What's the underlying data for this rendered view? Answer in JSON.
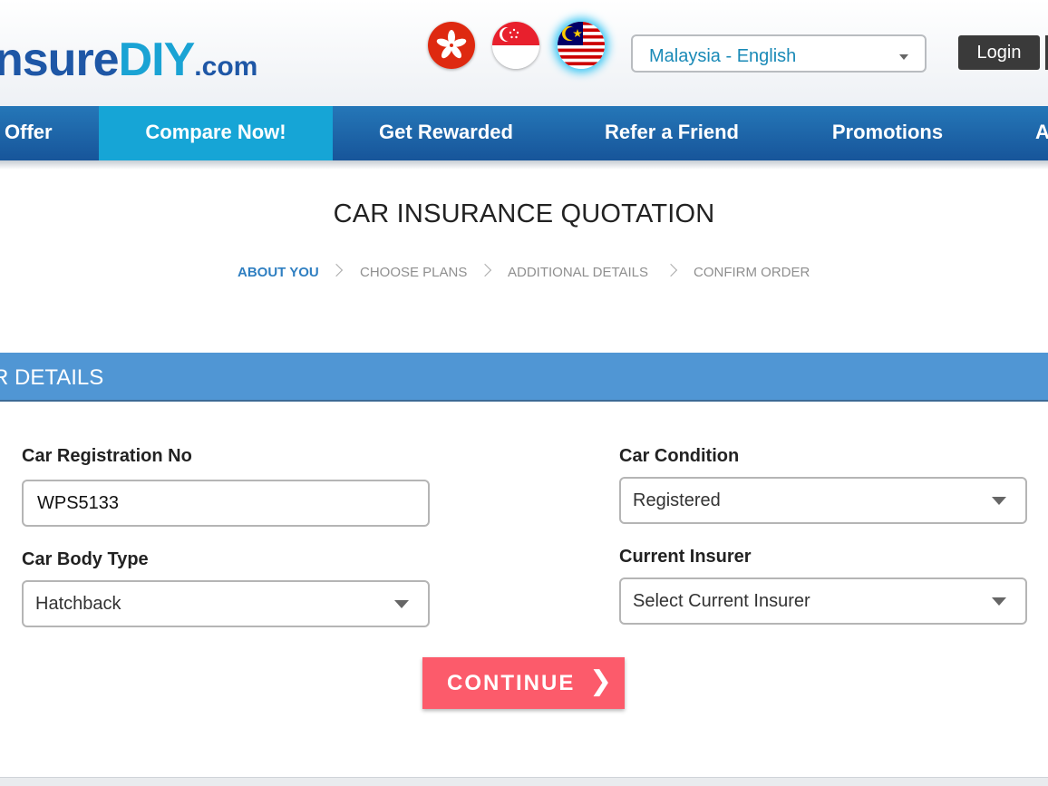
{
  "header": {
    "logo": {
      "part1": "nsure",
      "part2": "DIY",
      "part3": ".com"
    },
    "flags": [
      {
        "name": "hong-kong-flag",
        "country": "Hong Kong"
      },
      {
        "name": "singapore-flag",
        "country": "Singapore"
      },
      {
        "name": "malaysia-flag",
        "country": "Malaysia",
        "selected": true
      }
    ],
    "language_select": {
      "value": "Malaysia - English"
    },
    "login_label": "Login"
  },
  "nav": {
    "items": [
      {
        "label": "Offer"
      },
      {
        "label": "Compare Now!",
        "active": true
      },
      {
        "label": "Get Rewarded"
      },
      {
        "label": "Refer a Friend"
      },
      {
        "label": "Promotions"
      },
      {
        "label": "A"
      }
    ]
  },
  "page": {
    "title": "CAR INSURANCE QUOTATION",
    "steps": [
      {
        "label": "ABOUT YOU",
        "active": true
      },
      {
        "label": "CHOOSE PLANS"
      },
      {
        "label": "ADDITIONAL DETAILS"
      },
      {
        "label": "CONFIRM ORDER"
      }
    ],
    "section_title": "R DETAILS"
  },
  "form": {
    "registration": {
      "label": "Car Registration No",
      "value": "WPS5133"
    },
    "condition": {
      "label": "Car Condition",
      "value": "Registered"
    },
    "body_type": {
      "label": "Car Body Type",
      "value": "Hatchback"
    },
    "insurer": {
      "label": "Current Insurer",
      "value": "Select Current Insurer"
    },
    "continue_label": "CONTINUE",
    "continue_icon": "chevron-right-icon"
  },
  "colors": {
    "nav_bg": "#1f6aae",
    "nav_active": "#16a5d6",
    "section_bar": "#5096d4",
    "continue_btn": "#fc5b6b",
    "step_active": "#2f7fc1",
    "language_text": "#1a8ab7"
  }
}
